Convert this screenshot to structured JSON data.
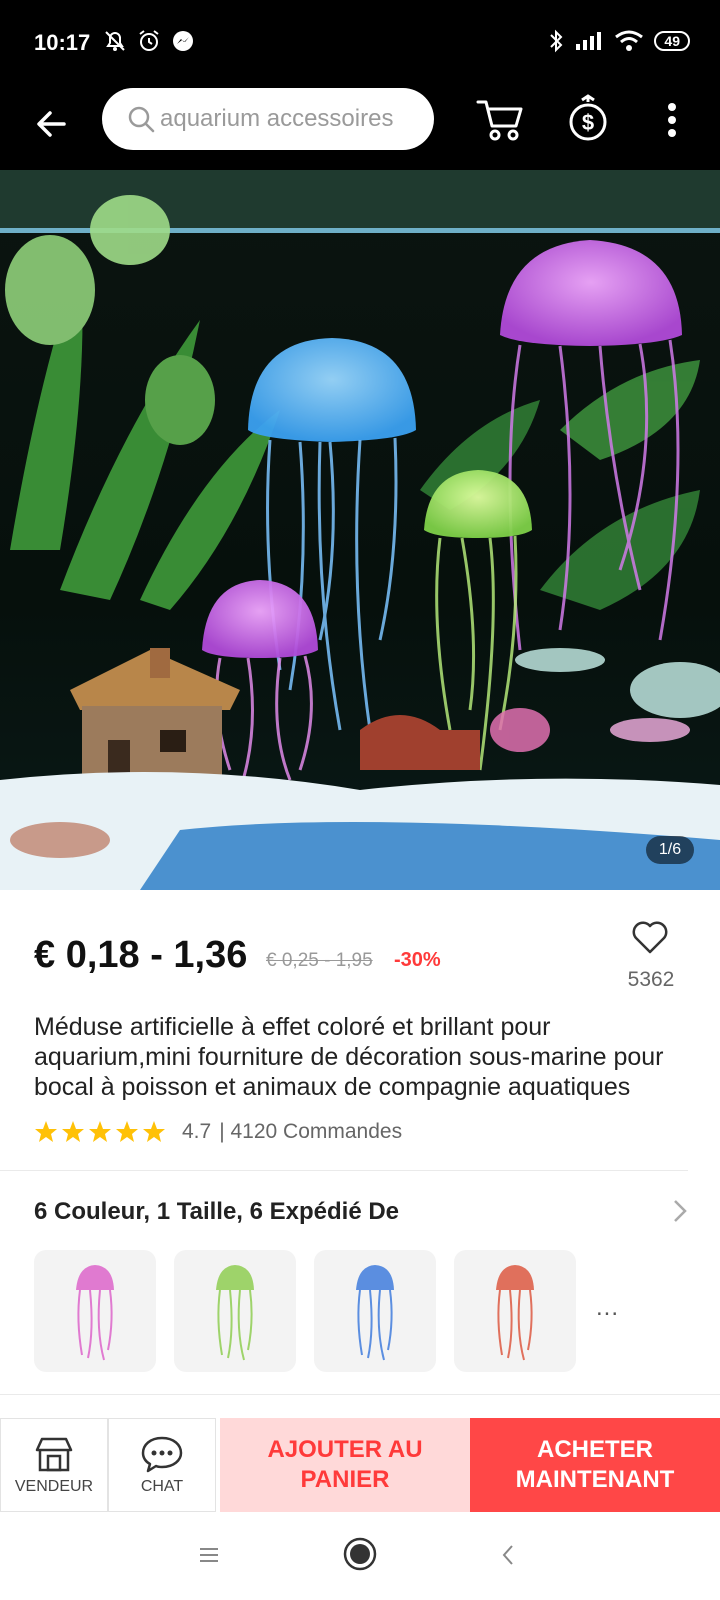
{
  "status_bar": {
    "time": "10:17",
    "battery": "49"
  },
  "header": {
    "search_placeholder": "aquarium accessoires"
  },
  "gallery": {
    "counter": "1/6"
  },
  "product": {
    "price": "€ 0,18 - 1,36",
    "old_price": "€ 0,25 - 1,95",
    "discount": "-30%",
    "wishlist_count": "5362",
    "title": "Méduse artificielle à effet coloré et brillant pour aquarium,mini fourniture de décoration sous-marine pour bocal à poisson et animaux de compagnie aquatiques",
    "rating": "4.7",
    "rating_stars": 5,
    "orders": "| 4120 Commandes"
  },
  "variants": {
    "summary": "6 Couleur, 1 Taille, 6 Expédié De",
    "more": "...",
    "swatches": [
      {
        "name": "pink",
        "color": "#e07ad0"
      },
      {
        "name": "green",
        "color": "#9ed36a"
      },
      {
        "name": "blue",
        "color": "#5b8ee0"
      },
      {
        "name": "red",
        "color": "#e0705c"
      }
    ]
  },
  "bottom_bar": {
    "store_label": "VENDEUR",
    "chat_label": "CHAT",
    "add_to_cart": "AJOUTER AU PANIER",
    "buy_now": "ACHETER MAINTENANT"
  },
  "colors": {
    "accent": "#ff4747",
    "accent_light": "#ffd9d9",
    "star": "#ffc107"
  }
}
